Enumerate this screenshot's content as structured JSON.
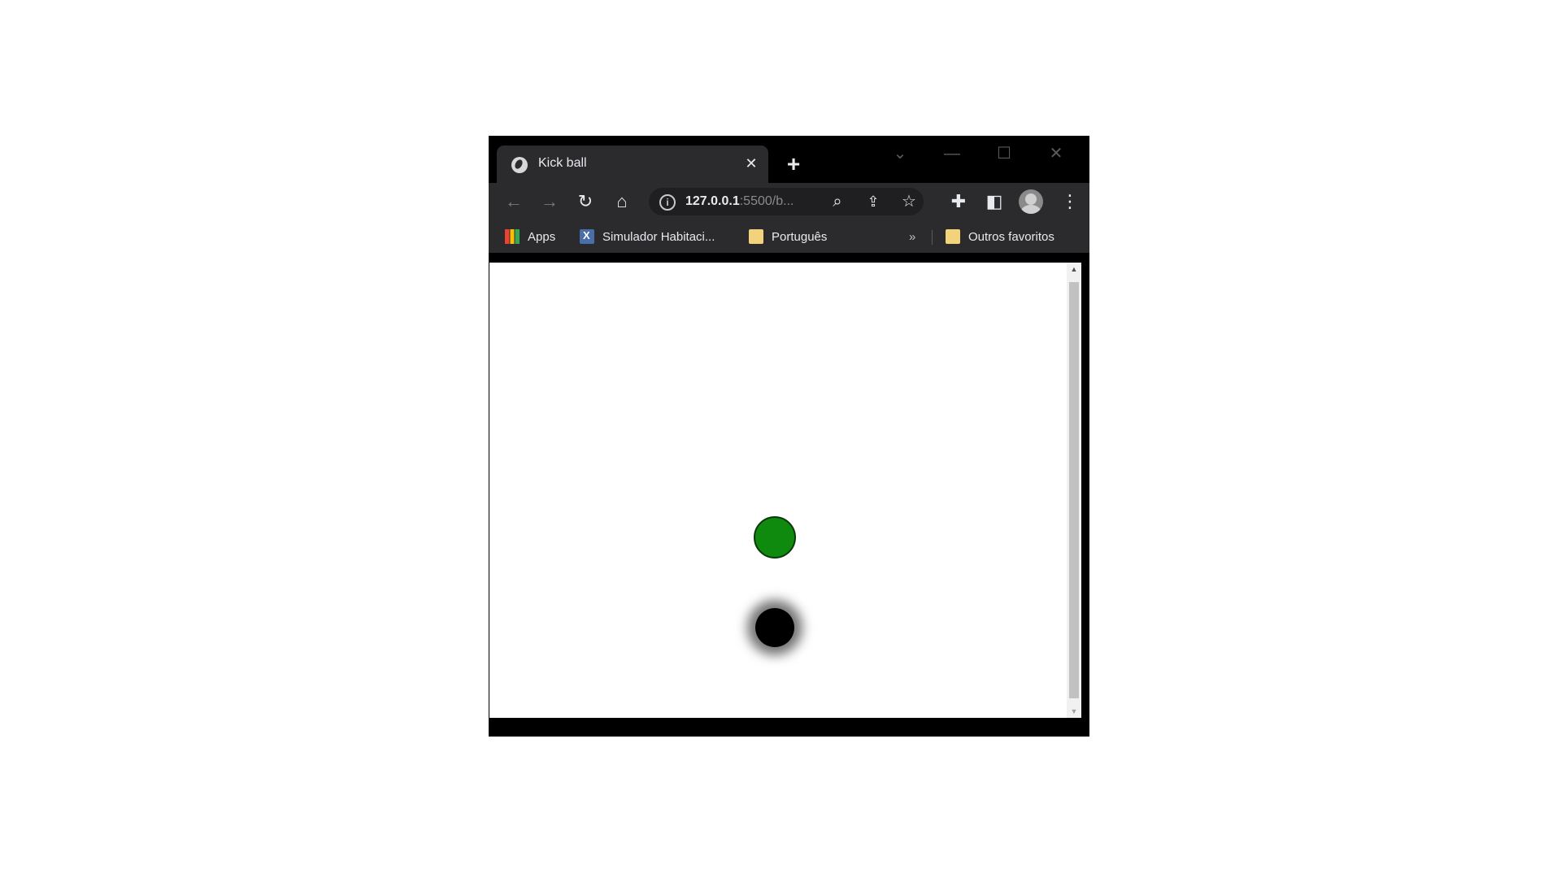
{
  "tab": {
    "title": "Kick ball",
    "close_glyph": "✕",
    "new_tab_glyph": "+"
  },
  "window_controls": {
    "tab_search_glyph": "⌄",
    "minimize_glyph": "—",
    "maximize_glyph": "☐",
    "close_glyph": "✕"
  },
  "toolbar": {
    "back_glyph": "←",
    "forward_glyph": "→",
    "reload_glyph": "↻",
    "home_glyph": "⌂",
    "extensions_glyph": "✚",
    "sidepanel_glyph": "◧",
    "menu_glyph": "⋮"
  },
  "omnibox": {
    "info_glyph": "i",
    "url_host": "127.0.0.1",
    "url_rest": ":5500/b...",
    "zoom_glyph": "⌕",
    "share_glyph": "⇪",
    "star_glyph": "☆"
  },
  "bookmarks": {
    "items": [
      {
        "label": "Apps"
      },
      {
        "label": "Simulador Habitaci..."
      },
      {
        "label": "Português"
      }
    ],
    "more_glyph": "»",
    "others_label": "Outros favoritos"
  },
  "scrollbar": {
    "up_glyph": "▲",
    "down_glyph": "▼"
  },
  "colors": {
    "green_ball": "#0f8a0f",
    "black_ball": "#000000",
    "browser_chrome": "#2b2b2e"
  }
}
